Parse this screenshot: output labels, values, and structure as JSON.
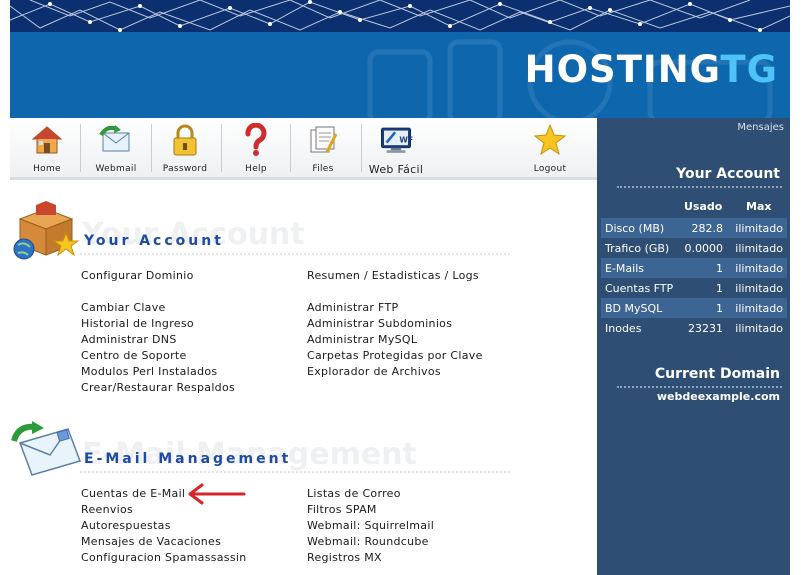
{
  "brand": {
    "logo_main": "HOSTING",
    "logo_accent": "TG"
  },
  "toolbar": {
    "items": [
      {
        "label": "Home",
        "icon": "house-icon"
      },
      {
        "label": "Webmail",
        "icon": "envelope-icon"
      },
      {
        "label": "Password",
        "icon": "padlock-icon"
      },
      {
        "label": "Help",
        "icon": "question-mark-icon"
      },
      {
        "label": "Files",
        "icon": "documents-icon"
      },
      {
        "label": "Web Fácil",
        "icon": "webfacil-icon",
        "badge": "WF"
      },
      {
        "label": "Logout",
        "icon": "star-icon"
      }
    ]
  },
  "sidebar": {
    "mensajes": "Mensajes",
    "account_title": "Your Account",
    "col_usado": "Usado",
    "col_max": "Max",
    "rows": [
      {
        "label": "Disco (MB)",
        "usado": "282.8",
        "max": "ilimitado"
      },
      {
        "label": "Trafico (GB)",
        "usado": "0.0000",
        "max": "ilimitado"
      },
      {
        "label": "E-Mails",
        "usado": "1",
        "max": "ilimitado"
      },
      {
        "label": "Cuentas FTP",
        "usado": "1",
        "max": "ilimitado"
      },
      {
        "label": "BD MySQL",
        "usado": "1",
        "max": "ilimitado"
      },
      {
        "label": "Inodes",
        "usado": "23231",
        "max": "ilimitado"
      }
    ],
    "domain_title": "Current Domain",
    "domain": "webdeexample.com"
  },
  "account": {
    "ghost": "Your Account",
    "title": "Your Account",
    "left_first": "Configurar Dominio",
    "right_first": "Resumen / Estadisticas / Logs",
    "left": [
      "Cambiar Clave",
      "Historial de Ingreso",
      "Administrar DNS",
      "Centro de Soporte",
      "Modulos Perl Instalados",
      "Crear/Restaurar Respaldos"
    ],
    "right": [
      "Administrar FTP",
      "Administrar Subdominios",
      "Administrar MySQL",
      "Carpetas Protegidas por Clave",
      "Explorador de Archivos"
    ]
  },
  "email": {
    "ghost": "E-Mail Management",
    "title": "E-Mail Management",
    "left": [
      "Cuentas de E-Mail",
      "Reenvios",
      "Autorespuestas",
      "Mensajes de Vacaciones",
      "Configuracion Spamassassin"
    ],
    "right": [
      "Listas de Correo",
      "Filtros SPAM",
      "Webmail: Squirrelmail",
      "Webmail: Roundcube",
      "Registros MX"
    ]
  },
  "colors": {
    "banner": "#0e67ad",
    "banner_top": "#0b2f6f",
    "panel": "#2f4e74",
    "panel_row": "#3d6593",
    "title_blue": "#1f4aa8",
    "arrow_red": "#d7262b"
  }
}
